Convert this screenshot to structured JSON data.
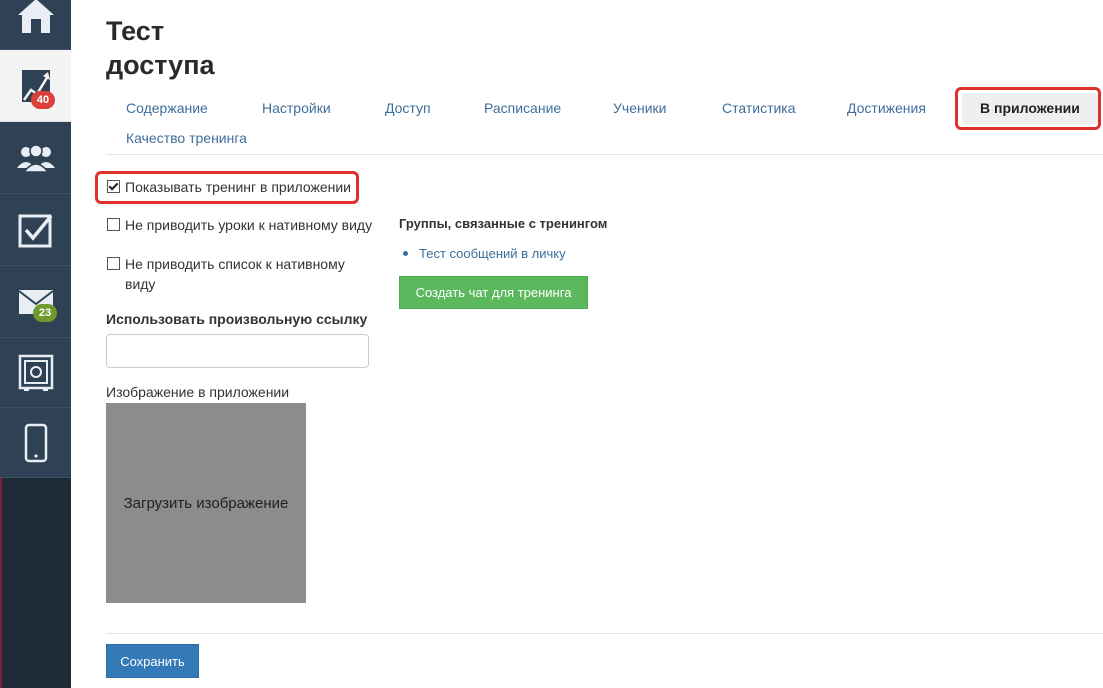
{
  "sidebar": {
    "items": [
      {
        "icon": "home-icon"
      },
      {
        "icon": "chart-icon",
        "badge": "40",
        "active": true
      },
      {
        "icon": "users-icon"
      },
      {
        "icon": "checkbox-icon"
      },
      {
        "icon": "mail-icon",
        "badge": "23"
      },
      {
        "icon": "safe-icon"
      },
      {
        "icon": "mobile-icon"
      }
    ]
  },
  "page": {
    "title_line1": "Тест",
    "title_line2": "доступа"
  },
  "tabs": [
    "Содержание",
    "Настройки",
    "Доступ",
    "Расписание",
    "Ученики",
    "Статистика",
    "Достижения",
    "В приложении",
    "Качество тренинга"
  ],
  "settings": {
    "show_in_app": {
      "label": "Показывать тренинг в приложении",
      "checked": true
    },
    "native_lessons": {
      "label": "Не приводить уроки к нативному виду",
      "checked": false
    },
    "native_list": {
      "label_line1": "Не приводить список к нативному",
      "label_line2": "виду",
      "checked": false
    },
    "custom_link_label": "Использовать произвольную ссылку",
    "custom_link_value": "",
    "image_label": "Изображение в приложении",
    "upload_label": "Загрузить изображение"
  },
  "groups": {
    "title": "Группы, связанные с тренингом",
    "items": [
      "Тест сообщений в личку"
    ],
    "create_chat_label": "Создать чат для тренинга"
  },
  "footer": {
    "save_label": "Сохранить"
  },
  "colors": {
    "sidebar": "#2e4155",
    "link": "#3f6e9b",
    "highlight": "#e0302b",
    "green_button": "#5cb85c",
    "blue_button": "#337ab7"
  }
}
